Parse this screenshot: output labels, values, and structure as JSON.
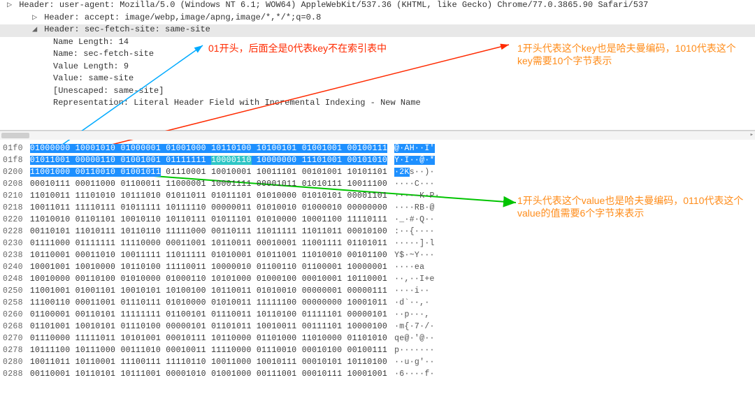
{
  "tree": {
    "row0": "Header: user-agent: Mozilla/5.0 (Windows NT 6.1; WOW64) AppleWebKit/537.36 (KHTML, like Gecko) Chrome/77.0.3865.90 Safari/537",
    "row1": "Header: accept: image/webp,image/apng,image/*,*/*;q=0.8",
    "row2": "Header: sec-fetch-site: same-site",
    "row3": "Name Length: 14",
    "row4": "Name: sec-fetch-site",
    "row5": "Value Length: 9",
    "row6": "Value: same-site",
    "row7": "[Unescaped: same-site]",
    "row8": "Representation: Literal Header Field with Incremental Indexing - New Name"
  },
  "annotations": {
    "red": "01开头，后面全是0代表key不在索引表中",
    "orange_top": "1开头代表这个key也是哈夫曼编码，1010代表这个key需要10个字节表示",
    "orange_bottom": "1开头代表这个value也是哈夫曼编码，0110代表这个value的值需要6个字节来表示"
  },
  "hex": {
    "offsets": [
      "01f0",
      "01f8",
      "0200",
      "0208",
      "0210",
      "0218",
      "0220",
      "0228",
      "0230",
      "0238",
      "0240",
      "0248",
      "0250",
      "0258",
      "0260",
      "0268",
      "0270",
      "0278",
      "0280",
      "0288"
    ],
    "bits": [
      [
        "01000000",
        "10001010",
        "01000001",
        "01001000",
        "10110100",
        "10100101",
        "01001001",
        "00100111"
      ],
      [
        "01011001",
        "00000110",
        "01001001",
        "01111111",
        "10000110",
        "10000000",
        "11101001",
        "00101010"
      ],
      [
        "11001000",
        "00110010",
        "01001011",
        "01110001",
        "10010001",
        "10011101",
        "00101001",
        "10101101"
      ],
      [
        "00010111",
        "00011000",
        "01100011",
        "11000001",
        "10001111",
        "00001011",
        "01010111",
        "10011100"
      ],
      [
        "11010011",
        "11101010",
        "10111010",
        "01011011",
        "01011101",
        "01010000",
        "01010101",
        "00001101"
      ],
      [
        "10011011",
        "11110111",
        "01011111",
        "10111110",
        "00000011",
        "01010010",
        "01000010",
        "00000000"
      ],
      [
        "11010010",
        "01101101",
        "10010110",
        "10110111",
        "01011101",
        "01010000",
        "10001100",
        "11110111"
      ],
      [
        "00110101",
        "11010111",
        "10110110",
        "11111000",
        "00110111",
        "11011111",
        "11011011",
        "00010100"
      ],
      [
        "01111000",
        "01111111",
        "11110000",
        "00011001",
        "10110011",
        "00010001",
        "11001111",
        "01101011"
      ],
      [
        "10110001",
        "00011010",
        "10011111",
        "11011111",
        "01010001",
        "01011001",
        "11010010",
        "00101100"
      ],
      [
        "10001001",
        "10010000",
        "10110100",
        "11110011",
        "10000010",
        "01100110",
        "01100001",
        "10000001"
      ],
      [
        "10010000",
        "00110100",
        "01010000",
        "01000110",
        "10101000",
        "01000100",
        "00010001",
        "10110001"
      ],
      [
        "11001001",
        "01001101",
        "10010101",
        "10100100",
        "10110011",
        "01010010",
        "00000001",
        "00000111"
      ],
      [
        "11100110",
        "00011001",
        "01110111",
        "01010000",
        "01010011",
        "11111100",
        "00000000",
        "10001011"
      ],
      [
        "01100001",
        "00110101",
        "11111111",
        "01100101",
        "01110011",
        "10110100",
        "01111101",
        "00000101"
      ],
      [
        "01101001",
        "10010101",
        "01110100",
        "00000101",
        "01101011",
        "10010011",
        "00111101",
        "10000100"
      ],
      [
        "01110000",
        "11111011",
        "10101001",
        "00010111",
        "10110000",
        "01101000",
        "11010000",
        "01101010"
      ],
      [
        "10111100",
        "10111000",
        "00111010",
        "00010011",
        "11110000",
        "01110010",
        "00010100",
        "00100111"
      ],
      [
        "10011011",
        "10110001",
        "11100111",
        "11110110",
        "10011000",
        "10010111",
        "00010101",
        "10110100"
      ],
      [
        "00110001",
        "10110101",
        "10111001",
        "00001010",
        "01001000",
        "00111001",
        "00010111",
        "10001001"
      ]
    ],
    "ascii": [
      "@·AH··I'",
      "Y·I··@·*",
      "·2Ks··)·",
      "····C···",
      "·····K·P·",
      "····RB·@",
      "·_·#·Q··",
      ":··{····",
      "·····]·l",
      "Y$·~Y···",
      "····ea",
      "··,··I+e",
      "····i··",
      "·d`··,·",
      "··p···,",
      "·m{·7·/·",
      "qe@·'@··",
      "p·······",
      "··u·g'··",
      "·6····f·"
    ]
  }
}
